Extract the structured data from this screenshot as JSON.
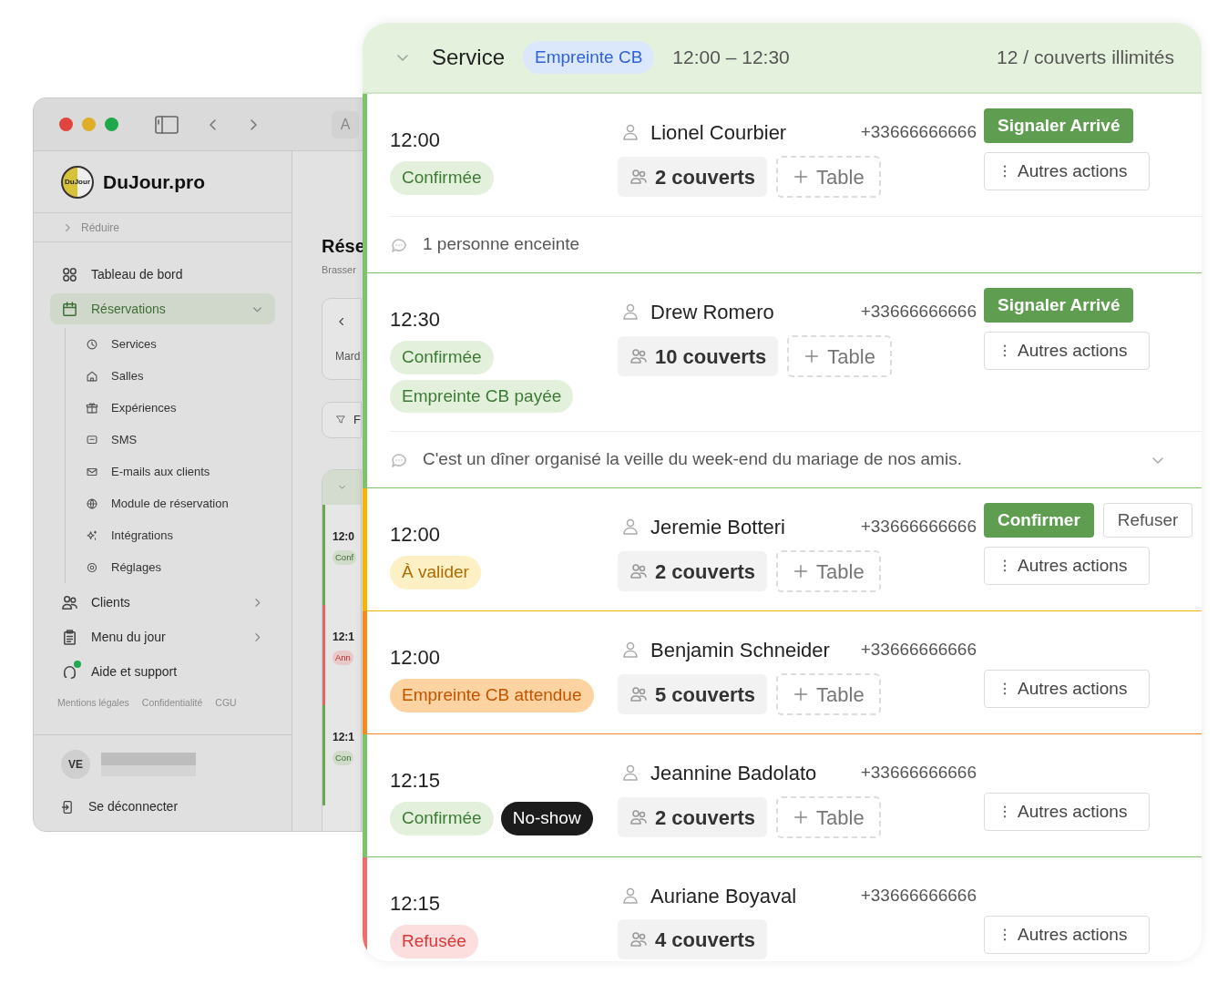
{
  "back_window": {
    "brand": "DuJour.pro",
    "logo_text": "DuJour",
    "toolbar_button": "A",
    "collapse": "Réduire",
    "nav": [
      {
        "label": "Tableau de bord",
        "selected": false
      },
      {
        "label": "Réservations",
        "selected": true,
        "expanded": true,
        "children": [
          {
            "label": "Services",
            "selected": false
          },
          {
            "label": "Salles",
            "selected": false
          },
          {
            "label": "Expériences",
            "selected": false
          },
          {
            "label": "SMS",
            "selected": false
          },
          {
            "label": "E-mails aux clients",
            "selected": false
          },
          {
            "label": "Module de réservation",
            "selected": false
          },
          {
            "label": "Intégrations",
            "selected": false
          },
          {
            "label": "Réglages",
            "selected": false
          }
        ]
      },
      {
        "label": "Clients",
        "selected": false,
        "expanded": false
      },
      {
        "label": "Menu du jour",
        "selected": false,
        "expanded": false
      },
      {
        "label": "Aide et support",
        "selected": false,
        "notification": true
      }
    ],
    "footer_links": [
      "Mentions légales",
      "Confidentialité",
      "CGU"
    ],
    "user": {
      "initials": "VE"
    },
    "logout": "Se déconnecter",
    "main": {
      "title": "Rése",
      "subtitle": "Brasser",
      "date_label": "Mard",
      "filter": "F",
      "list": [
        {
          "time": "12:0",
          "status": "Conf",
          "color": "#6aa84f"
        },
        {
          "time": "12:1",
          "status": "Ann",
          "color": "#e06666"
        },
        {
          "time": "12:1",
          "status": "Con",
          "color": "#6aa84f"
        }
      ]
    }
  },
  "service": {
    "expanded": true,
    "title": "Service",
    "badge": "Empreinte CB",
    "hours": "12:00 – 12:30",
    "capacity": "12 / couverts illimités",
    "reservations": [
      {
        "color": "#7cc36a",
        "time": "12:00",
        "badges": [
          {
            "label": "Confirmée",
            "kind": "success"
          }
        ],
        "name": "Lionel Courbier",
        "phone": "+33666666666",
        "covers": "2 couverts",
        "table_button": "Table",
        "actions": [
          {
            "label": "Signaler Arrivé",
            "kind": "primary"
          },
          {
            "label": "Autres actions",
            "kind": "more"
          }
        ],
        "note": {
          "text": "1 personne enceinte",
          "expandable": false
        }
      },
      {
        "color": "#7cc36a",
        "time": "12:30",
        "badges": [
          {
            "label": "Confirmée",
            "kind": "success"
          },
          {
            "label": "Empreinte CB payée",
            "kind": "success"
          }
        ],
        "name": "Drew Romero",
        "phone": "+33666666666",
        "covers": "10 couverts",
        "table_button": "Table",
        "actions": [
          {
            "label": "Signaler Arrivé",
            "kind": "primary"
          },
          {
            "label": "Autres actions",
            "kind": "more"
          }
        ],
        "note": {
          "text": "C'est un dîner organisé la veille du week-end du mariage de nos amis.",
          "expandable": true
        }
      },
      {
        "color": "#f7b500",
        "time": "12:00",
        "badges": [
          {
            "label": "À valider",
            "kind": "warning"
          }
        ],
        "name": "Jeremie Botteri",
        "phone": "+33666666666",
        "covers": "2 couverts",
        "table_button": "Table",
        "actions": [
          {
            "label": "Confirmer",
            "kind": "primary"
          },
          {
            "label": "Refuser",
            "kind": "outline"
          },
          {
            "label": "Autres actions",
            "kind": "more"
          }
        ]
      },
      {
        "color": "#f58a1f",
        "time": "12:00",
        "badges": [
          {
            "label": "Empreinte CB attendue",
            "kind": "pending_payment"
          }
        ],
        "name": "Benjamin Schneider",
        "phone": "+33666666666",
        "covers": "5 couverts",
        "table_button": "Table",
        "actions": [
          {
            "label": "Autres actions",
            "kind": "more"
          }
        ]
      },
      {
        "color": "#7cc36a",
        "time": "12:15",
        "badges": [
          {
            "label": "Confirmée",
            "kind": "success"
          },
          {
            "label": "No-show",
            "kind": "dark"
          }
        ],
        "name": "Jeannine Badolato",
        "phone": "+33666666666",
        "covers": "2 couverts",
        "table_button": "Table",
        "actions": [
          {
            "label": "Autres actions",
            "kind": "more"
          }
        ]
      },
      {
        "color": "#f06b6b",
        "time": "12:15",
        "badges": [
          {
            "label": "Refusée",
            "kind": "danger"
          }
        ],
        "name": "Auriane Boyaval",
        "phone": "+33666666666",
        "covers": "4 couverts",
        "actions": [
          {
            "label": "Autres actions",
            "kind": "more"
          }
        ]
      }
    ]
  }
}
